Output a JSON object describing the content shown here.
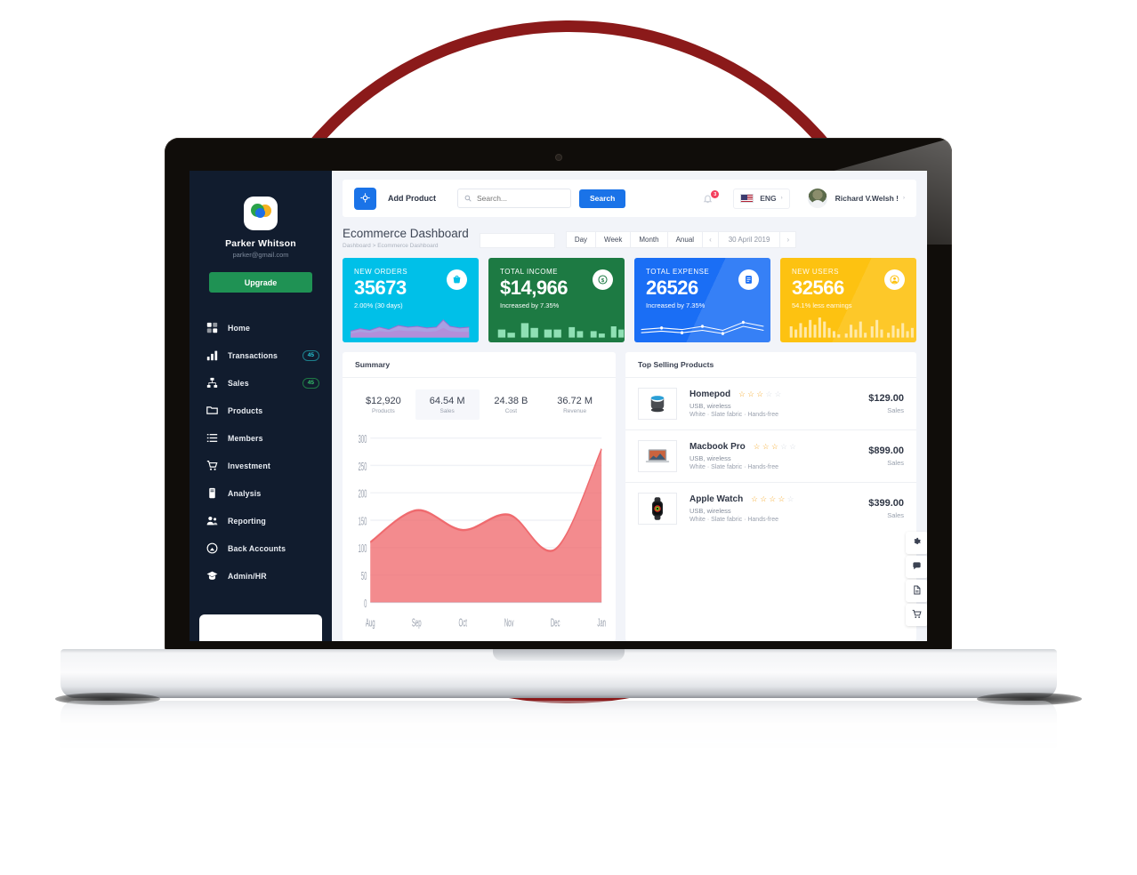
{
  "sidebar": {
    "logo_icon": "bubbles-logo-icon",
    "user_name": "Parker Whitson",
    "user_email": "parker@gmail.com",
    "upgrade_label": "Upgrade",
    "items": [
      {
        "label": "Home",
        "icon": "home-grid-icon",
        "badge": ""
      },
      {
        "label": "Transactions",
        "icon": "bar-chart-icon",
        "badge": "45",
        "badge_style": "cyan"
      },
      {
        "label": "Sales",
        "icon": "sales-node-icon",
        "badge": "45",
        "badge_style": "green"
      },
      {
        "label": "Products",
        "icon": "folder-icon",
        "badge": ""
      },
      {
        "label": "Members",
        "icon": "list-icon",
        "badge": ""
      },
      {
        "label": "Investment",
        "icon": "cart-icon",
        "badge": ""
      },
      {
        "label": "Analysis",
        "icon": "document-icon",
        "badge": ""
      },
      {
        "label": "Reporting",
        "icon": "people-icon",
        "badge": ""
      },
      {
        "label": "Back Accounts",
        "icon": "compass-icon",
        "badge": ""
      },
      {
        "label": "Admin/HR",
        "icon": "graduation-icon",
        "badge": ""
      }
    ]
  },
  "topbar": {
    "add_product_label": "Add Product",
    "add_product_icon": "plus-target-icon",
    "search_placeholder": "Search...",
    "search_value": "",
    "search_button_label": "Search",
    "search_icon": "search-icon",
    "bell_icon": "bell-icon",
    "notification_count": "3",
    "flag_icon": "us-flag-icon",
    "language": "ENG",
    "caret": "›",
    "avatar_icon": "user-avatar",
    "user_label": "Richard V.Welsh !"
  },
  "page": {
    "title": "Ecommerce Dashboard",
    "breadcrumb": "Dashboard > Ecommerce Dashboard",
    "filter_input_value": "",
    "range_options": [
      "Day",
      "Week",
      "Month",
      "Anual"
    ],
    "prev_arrow": "‹",
    "next_arrow": "›",
    "date": "30 April 2019"
  },
  "stat_cards": [
    {
      "label": "NEW ORDERS",
      "value": "35673",
      "sub": "2.00% (30 days)",
      "icon": "basket-icon",
      "bg": "#00c0e8",
      "spark": "area"
    },
    {
      "label": "TOTAL INCOME",
      "value": "$14,966",
      "sub": "Increased by 7.35%",
      "icon": "dollar-coin-icon",
      "bg": "#1d7a43",
      "spark": "bars"
    },
    {
      "label": "TOTAL EXPENSE",
      "value": "26526",
      "sub": "Increased by 7.35%",
      "icon": "report-icon",
      "bg": "#1a6ef5",
      "spark": "lines"
    },
    {
      "label": "NEW USERS",
      "value": "32566",
      "sub": "54.1% less earnings",
      "icon": "person-icon",
      "bg": "#fdc211",
      "spark": "thinbars"
    }
  ],
  "summary": {
    "title": "Summary",
    "stats": [
      {
        "value": "$12,920",
        "label": "Products",
        "active": false
      },
      {
        "value": "64.54 M",
        "label": "Sales",
        "active": true
      },
      {
        "value": "24.38 B",
        "label": "Cost",
        "active": false
      },
      {
        "value": "36.72 M",
        "label": "Revenue",
        "active": false
      }
    ]
  },
  "chart_data": {
    "type": "area",
    "title": "Summary",
    "categories": [
      "Aug",
      "Sep",
      "Oct",
      "Nov",
      "Dec",
      "Jan"
    ],
    "values": [
      110,
      168,
      132,
      160,
      97,
      280
    ],
    "yticks": [
      0,
      50,
      100,
      150,
      200,
      250,
      300
    ],
    "ylim": [
      0,
      300
    ],
    "xlabel": "",
    "ylabel": "",
    "grid": true,
    "series_color": "#ef6a6e",
    "fill_color": "#ef6a6e",
    "legend": "none"
  },
  "top_selling": {
    "title": "Top Selling Products",
    "products": [
      {
        "name": "Homepod",
        "rating": 3,
        "max_rating": 5,
        "meta1": "USB, wireless",
        "meta2": "White · Slate fabric · Hands-free",
        "price": "$129.00",
        "price_sub": "Sales",
        "thumb": "homepod-thumb"
      },
      {
        "name": "Macbook Pro",
        "rating": 3,
        "max_rating": 5,
        "meta1": "USB, wireless",
        "meta2": "White · Slate fabric · Hands-free",
        "price": "$899.00",
        "price_sub": "Sales",
        "thumb": "macbook-thumb"
      },
      {
        "name": "Apple Watch",
        "rating": 4,
        "max_rating": 5,
        "meta1": "USB, wireless",
        "meta2": "White · Slate fabric · Hands-free",
        "price": "$399.00",
        "price_sub": "Sales",
        "thumb": "applewatch-thumb"
      }
    ]
  },
  "float_tools": [
    {
      "icon": "gear-icon"
    },
    {
      "icon": "chat-icon"
    },
    {
      "icon": "file-icon"
    },
    {
      "icon": "cart-icon"
    }
  ],
  "colors": {
    "sidebar_bg": "#111c2e",
    "accent_blue": "#1a73e8",
    "upgrade_green": "#1f9254",
    "ring_red": "#8B1A1A",
    "page_bg": "#f2f4f9"
  }
}
